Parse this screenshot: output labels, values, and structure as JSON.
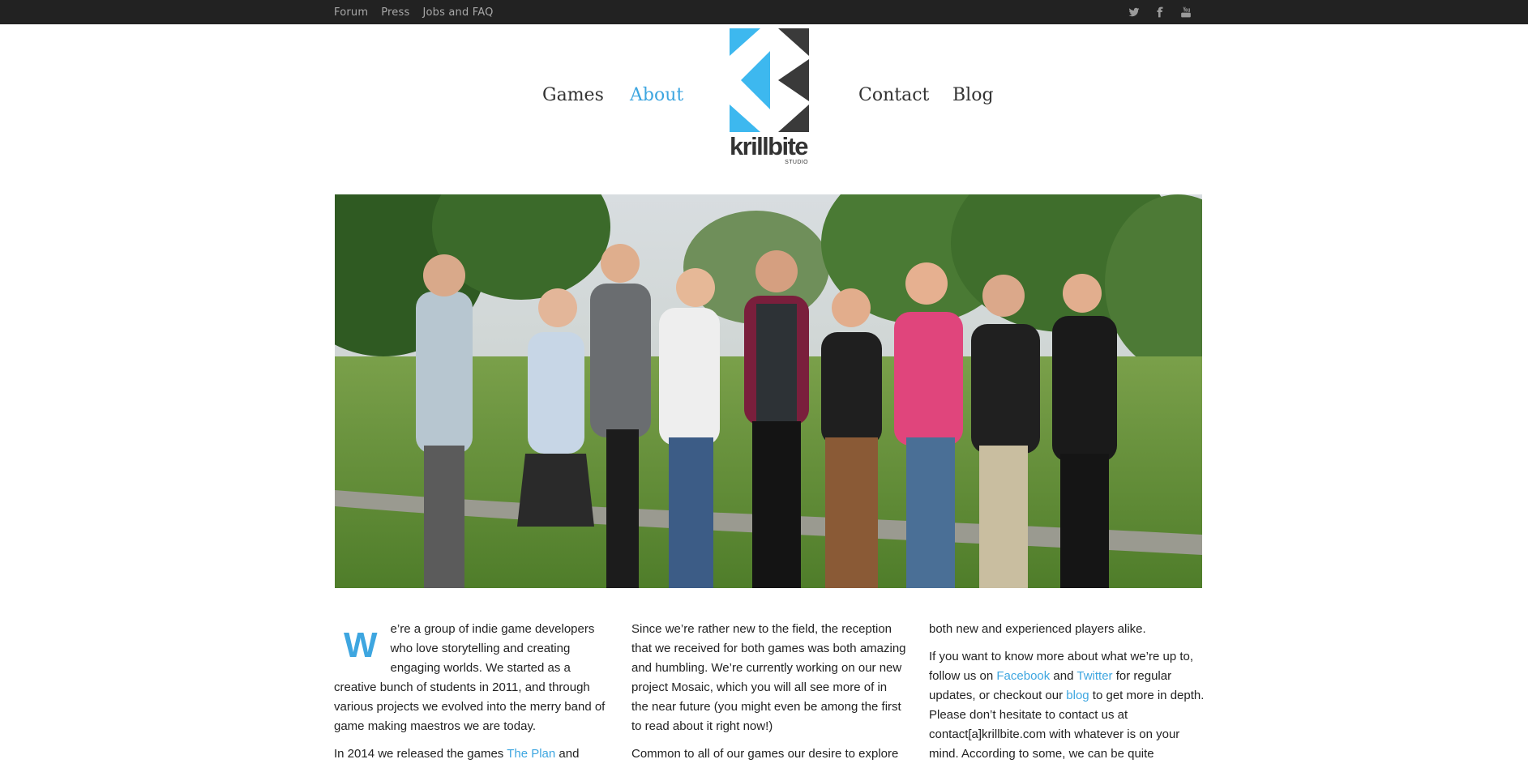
{
  "topbar": {
    "links": [
      "Forum",
      "Press",
      "Jobs and FAQ"
    ],
    "social_icons": [
      "twitter-icon",
      "facebook-icon",
      "youtube-icon"
    ]
  },
  "nav": {
    "games": "Games",
    "about": "About",
    "contact": "Contact",
    "blog": "Blog",
    "active_color": "#3ea6e0"
  },
  "logo": {
    "name": "krillbite",
    "sub": "STUDIO",
    "colors": {
      "blue": "#3db8ef",
      "dark": "#3a3a3a"
    }
  },
  "hero": {
    "description_icon": "team-photo-image"
  },
  "about": {
    "dropcap": "W",
    "p1": "e’re a group of indie game developers who love storytelling and creating engaging worlds. We started as a creative bunch of students in 2011, and through various projects we evolved into the merry band of game making maestros we are today.",
    "p2_start": "In 2014 we released the games ",
    "p2_link": "The Plan",
    "p2_end": " and",
    "p3": "Since we’re rather new to the field, the reception that we received for both games was both amazing and humbling. We’re currently working on our new project Mosaic, which you will all see more of in the near future (you might even be among the first to read about it right now!)",
    "p4": "Common to all of our games our desire to explore",
    "p5": "both new and experienced players alike.",
    "p6_a": "If you want to know more about what we’re up to, follow us on ",
    "p6_facebook": "Facebook",
    "p6_b": " and ",
    "p6_twitter": "Twitter",
    "p6_c": " for regular updates, or checkout our ",
    "p6_blog": "blog",
    "p6_d": " to get more in depth. Please don’t hesitate to contact us at contact[a]krillbite.com with whatever is on your mind. According to some, we can be quite"
  }
}
